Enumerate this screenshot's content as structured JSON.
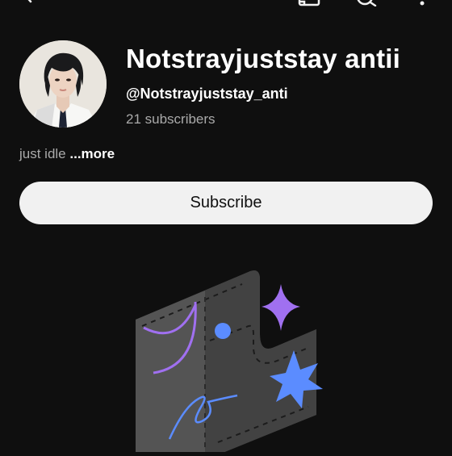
{
  "header": {
    "icons": [
      "back-arrow-icon",
      "cast-icon",
      "search-icon",
      "more-vert-icon"
    ]
  },
  "channel": {
    "name": "Notstrayjuststay antii",
    "handle": "@Notstrayjuststay_anti",
    "subscribers": "21 subscribers",
    "description": "just idle",
    "more_label": "...more"
  },
  "actions": {
    "subscribe_label": "Subscribe"
  },
  "colors": {
    "background": "#0f0f0f",
    "primary_text": "#ffffff",
    "secondary_text": "#aaaaaa",
    "button_bg": "#f1f1f1",
    "illustration_purple": "#a070f0",
    "illustration_blue": "#5b8cff"
  }
}
